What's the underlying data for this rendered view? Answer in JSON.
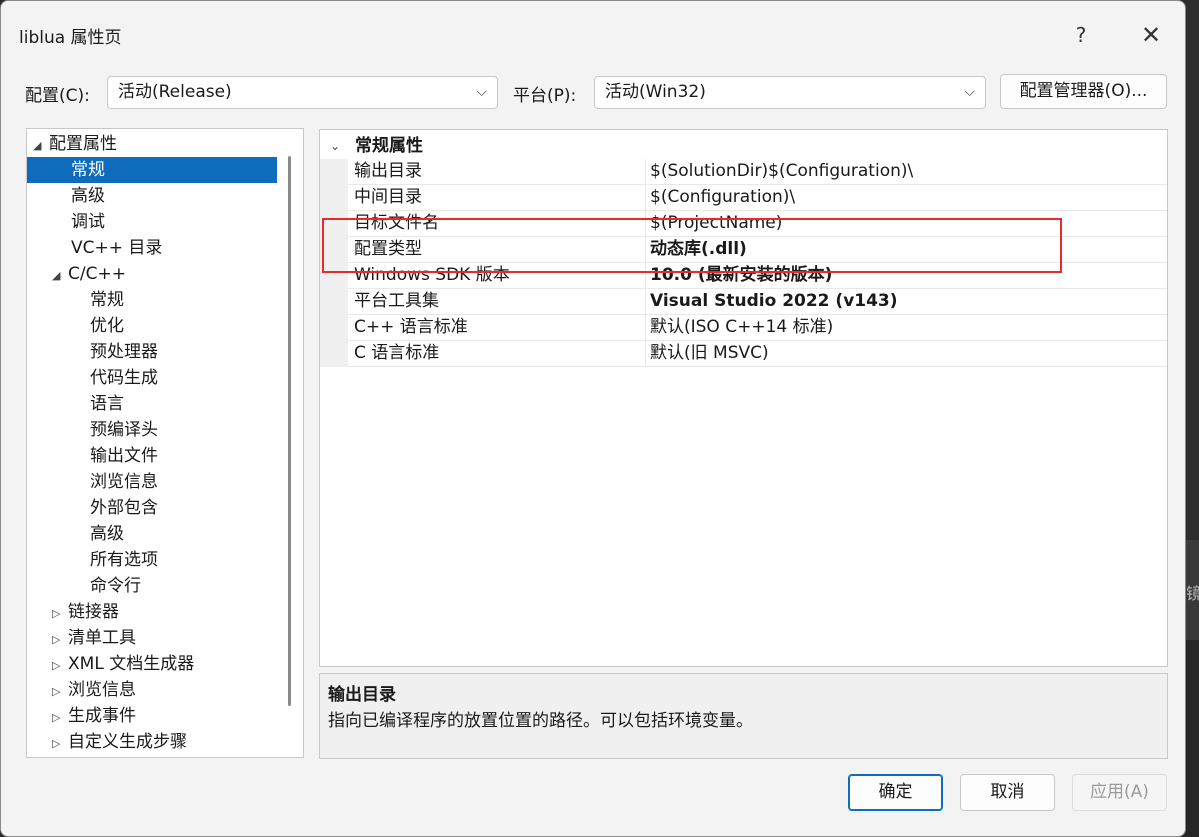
{
  "window": {
    "title": "liblua 属性页",
    "help_glyph": "?",
    "close_glyph": "✕"
  },
  "config_bar": {
    "config_label": "配置(C):",
    "config_value": "活动(Release)",
    "platform_label": "平台(P):",
    "platform_value": "活动(Win32)",
    "manager_button": "配置管理器(O)..."
  },
  "tree": {
    "items": [
      {
        "label": "配置属性",
        "twisty": "◢",
        "level": 0
      },
      {
        "label": "常规",
        "twisty": "",
        "level": 1,
        "selected": true
      },
      {
        "label": "高级",
        "twisty": "",
        "level": 1
      },
      {
        "label": "调试",
        "twisty": "",
        "level": 1
      },
      {
        "label": "VC++ 目录",
        "twisty": "",
        "level": 1
      },
      {
        "label": "C/C++",
        "twisty": "◢",
        "level": 1
      },
      {
        "label": "常规",
        "twisty": "",
        "level": 2
      },
      {
        "label": "优化",
        "twisty": "",
        "level": 2
      },
      {
        "label": "预处理器",
        "twisty": "",
        "level": 2
      },
      {
        "label": "代码生成",
        "twisty": "",
        "level": 2
      },
      {
        "label": "语言",
        "twisty": "",
        "level": 2
      },
      {
        "label": "预编译头",
        "twisty": "",
        "level": 2
      },
      {
        "label": "输出文件",
        "twisty": "",
        "level": 2
      },
      {
        "label": "浏览信息",
        "twisty": "",
        "level": 2
      },
      {
        "label": "外部包含",
        "twisty": "",
        "level": 2
      },
      {
        "label": "高级",
        "twisty": "",
        "level": 2
      },
      {
        "label": "所有选项",
        "twisty": "",
        "level": 2
      },
      {
        "label": "命令行",
        "twisty": "",
        "level": 2
      },
      {
        "label": "链接器",
        "twisty": "▷",
        "level": 1
      },
      {
        "label": "清单工具",
        "twisty": "▷",
        "level": 1
      },
      {
        "label": "XML 文档生成器",
        "twisty": "▷",
        "level": 1
      },
      {
        "label": "浏览信息",
        "twisty": "▷",
        "level": 1
      },
      {
        "label": "生成事件",
        "twisty": "▷",
        "level": 1
      },
      {
        "label": "自定义生成步骤",
        "twisty": "▷",
        "level": 1
      }
    ]
  },
  "grid": {
    "category": "常规属性",
    "category_twisty": "⌄",
    "rows": [
      {
        "name": "输出目录",
        "value": "$(SolutionDir)$(Configuration)\\",
        "bold": false
      },
      {
        "name": "中间目录",
        "value": "$(Configuration)\\",
        "bold": false
      },
      {
        "name": "目标文件名",
        "value": "$(ProjectName)",
        "bold": false
      },
      {
        "name": "配置类型",
        "value": "动态库(.dll)",
        "bold": true
      },
      {
        "name": "Windows SDK 版本",
        "value": "10.0 (最新安装的版本)",
        "bold": true
      },
      {
        "name": "平台工具集",
        "value": "Visual Studio 2022 (v143)",
        "bold": true
      },
      {
        "name": "C++ 语言标准",
        "value": "默认(ISO C++14 标准)",
        "bold": false
      },
      {
        "name": "C 语言标准",
        "value": "默认(旧 MSVC)",
        "bold": false
      }
    ]
  },
  "description": {
    "title": "输出目录",
    "text": "指向已编译程序的放置位置的路径。可以包括环境变量。"
  },
  "footer": {
    "ok": "确定",
    "cancel": "取消",
    "apply": "应用(A)"
  },
  "background": {
    "glyph": "镜"
  },
  "colors": {
    "selection": "#0f6cbd",
    "highlight_box": "#e52b2b",
    "disabled_text": "#9a9a9a"
  }
}
